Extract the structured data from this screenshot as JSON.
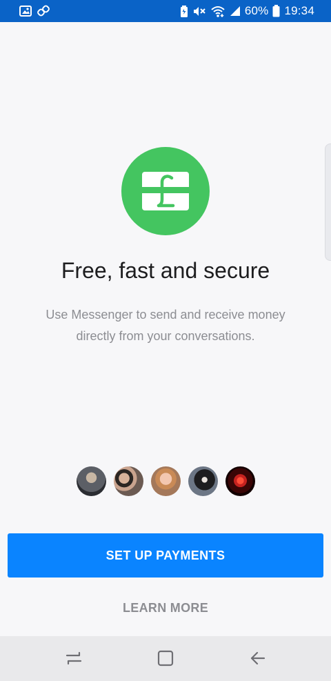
{
  "status_bar": {
    "battery": "60%",
    "time": "19:34",
    "icons": [
      "image-icon",
      "link-icon",
      "battery-saver-icon",
      "mute-icon",
      "wifi-icon",
      "signal-icon",
      "battery-icon"
    ]
  },
  "main": {
    "hero_icon": "pound-card-icon",
    "title": "Free, fast and secure",
    "subtitle_lines": [
      "Use Messenger to send and receive money",
      "directly from your conversations."
    ],
    "avatars": [
      "avatar-1",
      "avatar-2",
      "avatar-3",
      "avatar-4",
      "avatar-5"
    ]
  },
  "actions": {
    "primary": "SET UP PAYMENTS",
    "secondary": "LEARN MORE"
  },
  "navigation": {
    "recents_icon": "recents-icon",
    "home_icon": "home-icon",
    "back_icon": "back-icon"
  },
  "colors": {
    "status_bar": "#0A63C7",
    "hero": "#44C560",
    "primary_button": "#0A84FF",
    "background": "#F7F7F9",
    "nav_bar": "#E9E9EB"
  }
}
